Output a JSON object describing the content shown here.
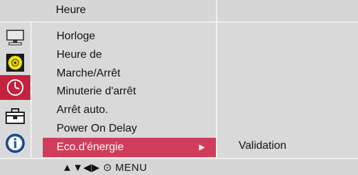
{
  "header": {
    "title": "Heure"
  },
  "icons": [
    {
      "name": "picture-monitor-icon",
      "active": false
    },
    {
      "name": "audio-speaker-icon",
      "active": false
    },
    {
      "name": "time-clock-icon",
      "active": true
    },
    {
      "name": "option-toolbox-icon",
      "active": false
    },
    {
      "name": "information-icon",
      "active": false
    }
  ],
  "menu": {
    "items": [
      {
        "label": "Horloge"
      },
      {
        "label": "Heure de"
      },
      {
        "label": "Marche/Arrêt"
      },
      {
        "label": "Minuterie d'arrêt"
      },
      {
        "label": "Arrêt auto."
      },
      {
        "label": "Power On Delay"
      },
      {
        "label": "Eco.d'énergie",
        "selected": true
      }
    ]
  },
  "submenu": {
    "value": "Validation"
  },
  "footer": {
    "hint": "▲▼◀▶ ⊙    MENU"
  },
  "colors": {
    "active_icon_bg": "#c4223d",
    "selected_item_bg": "#d03d5a",
    "panel_bg": "#d9d9d9"
  }
}
